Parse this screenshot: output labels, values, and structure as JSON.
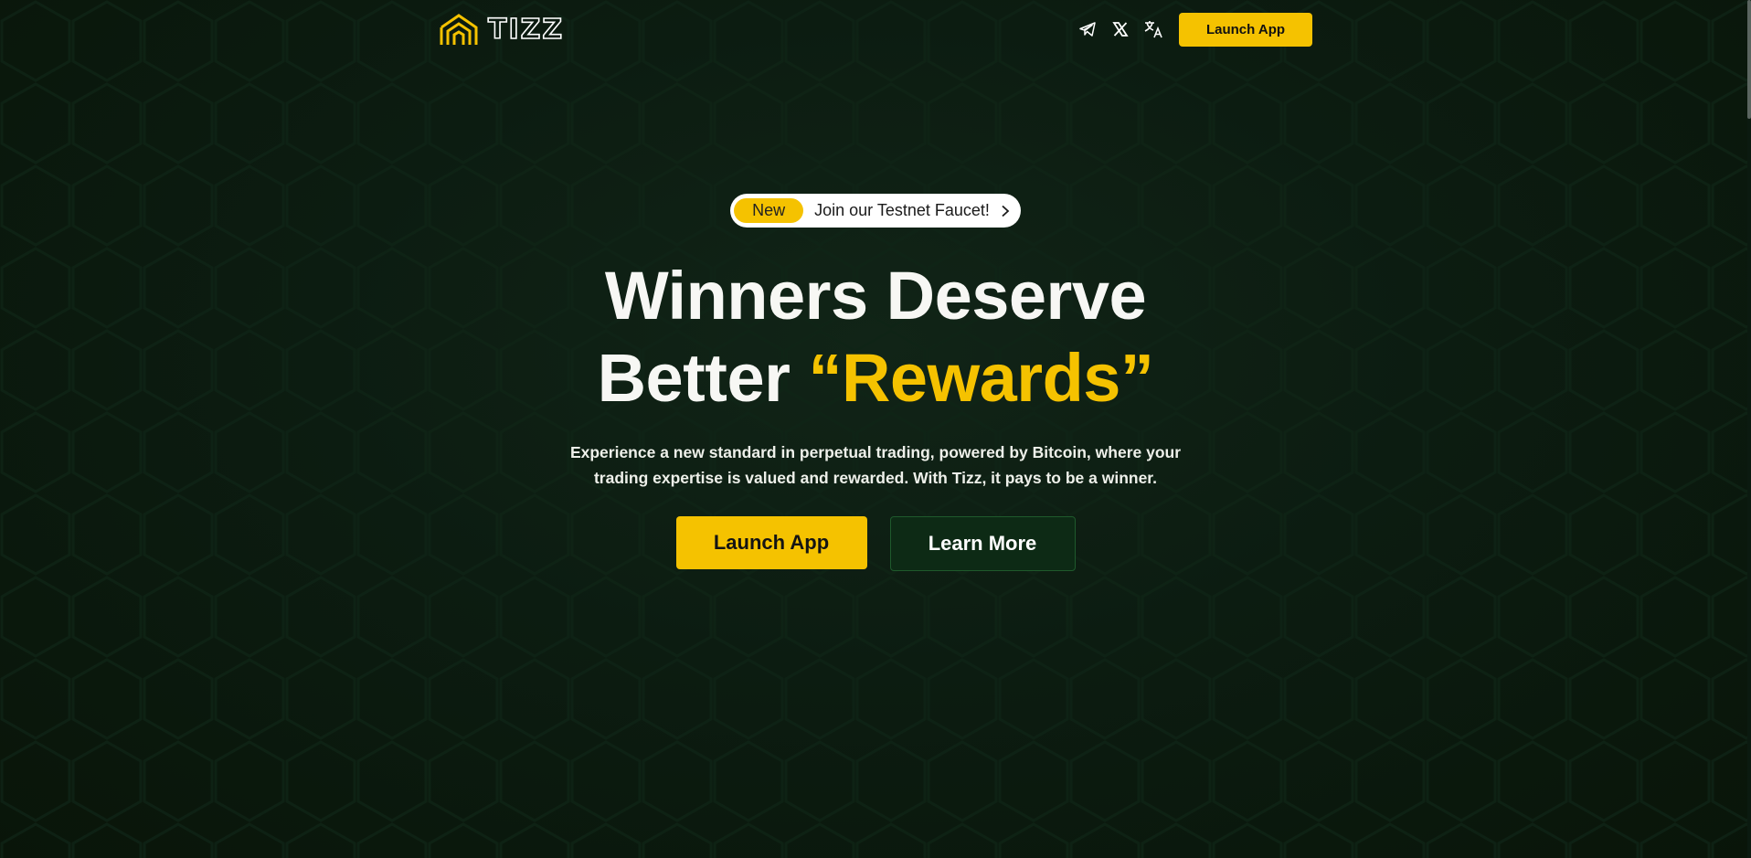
{
  "brand": {
    "name": "TIZZ",
    "logo_icon": "tizz-hex-logo-icon"
  },
  "nav": {
    "icons": [
      "telegram-icon",
      "x-twitter-icon",
      "translate-icon"
    ],
    "launch_label": "Launch App"
  },
  "announcement": {
    "badge": "New",
    "text": "Join our Testnet Faucet!",
    "icon": "chevron-right-icon"
  },
  "hero": {
    "headline_line1": "Winners Deserve",
    "headline_line2_prefix": "Better",
    "headline_line2_accent": "“Rewards”",
    "subtext": "Experience a new standard in perpetual trading, powered by Bitcoin, where your trading expertise is valued and rewarded. With Tizz, it pays to be a winner."
  },
  "cta": {
    "primary_label": "Launch App",
    "secondary_label": "Learn More"
  },
  "colors": {
    "accent": "#f5c200",
    "background": "#0b1a10",
    "secondary_button": "#0d2a15"
  }
}
